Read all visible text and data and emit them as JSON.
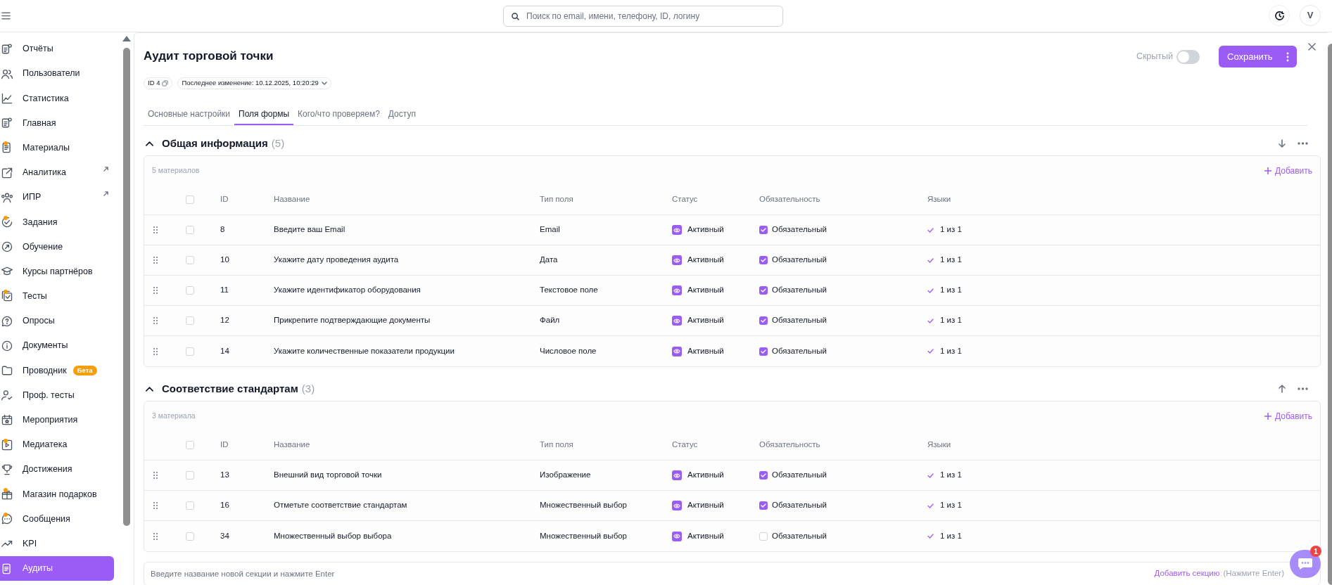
{
  "search": {
    "placeholder": "Поиск по email, имени, телефону, ID, логину"
  },
  "user": {
    "avatar": "V"
  },
  "sidebar": {
    "items": [
      {
        "label": "Отчёты",
        "notify": false,
        "external": false,
        "selected": false
      },
      {
        "label": "Пользователи",
        "notify": false,
        "external": false,
        "selected": false
      },
      {
        "label": "Статистика",
        "notify": false,
        "external": false,
        "selected": false
      },
      {
        "label": "Главная",
        "notify": false,
        "external": false,
        "selected": false
      },
      {
        "label": "Материалы",
        "notify": true,
        "external": false,
        "selected": false
      },
      {
        "label": "Аналитика",
        "notify": false,
        "external": true,
        "selected": false
      },
      {
        "label": "ИПР",
        "notify": false,
        "external": true,
        "selected": false
      },
      {
        "label": "Задания",
        "notify": true,
        "external": false,
        "selected": false
      },
      {
        "label": "Обучение",
        "notify": false,
        "external": false,
        "selected": false
      },
      {
        "label": "Курсы партнёров",
        "notify": false,
        "external": false,
        "selected": false
      },
      {
        "label": "Тесты",
        "notify": true,
        "external": false,
        "selected": false
      },
      {
        "label": "Опросы",
        "notify": false,
        "external": false,
        "selected": false
      },
      {
        "label": "Документы",
        "notify": false,
        "external": false,
        "selected": false
      },
      {
        "label": "Проводник",
        "notify": false,
        "external": false,
        "selected": false,
        "badge": "Бета"
      },
      {
        "label": "Проф. тесты",
        "notify": false,
        "external": false,
        "selected": false
      },
      {
        "label": "Мероприятия",
        "notify": false,
        "external": false,
        "selected": false
      },
      {
        "label": "Медиатека",
        "notify": true,
        "external": false,
        "selected": false
      },
      {
        "label": "Достижения",
        "notify": false,
        "external": false,
        "selected": false
      },
      {
        "label": "Магазин подарков",
        "notify": true,
        "external": false,
        "selected": false
      },
      {
        "label": "Сообщения",
        "notify": true,
        "external": false,
        "selected": false
      },
      {
        "label": "KPI",
        "notify": false,
        "external": false,
        "selected": false
      },
      {
        "label": "Аудиты",
        "notify": false,
        "external": false,
        "selected": true
      }
    ]
  },
  "page": {
    "title": "Аудит торговой точки",
    "id_chip": "ID 4",
    "last_change": "Последнее изменение: 10.12.2025, 10:20:29",
    "hidden_toggle": {
      "label": "Скрытый",
      "on": false
    },
    "save_button": "Сохранить"
  },
  "tabs": [
    {
      "label": "Основные настройки",
      "selected": false
    },
    {
      "label": "Поля формы",
      "selected": true
    },
    {
      "label": "Кого/что проверяем?",
      "selected": false
    },
    {
      "label": "Доступ",
      "selected": false
    }
  ],
  "sections": [
    {
      "title": "Общая информация",
      "count": "(5)",
      "expanded": true,
      "can_move_down": true,
      "can_move_up": false,
      "materials": "5 материалов",
      "add": "Добавить",
      "all_checked": false,
      "columns": [
        "ID",
        "Название",
        "Тип поля",
        "Статус",
        "Обязательность",
        "Языки"
      ],
      "rows": [
        {
          "checked": false,
          "id": "8",
          "name": "Введите ваш Email",
          "type": "Email",
          "status": "Активный",
          "required": true,
          "required_label": "Обязательный",
          "languages": "1 из 1"
        },
        {
          "checked": false,
          "id": "10",
          "name": "Укажите дату проведения аудита",
          "type": "Дата",
          "status": "Активный",
          "required": true,
          "required_label": "Обязательный",
          "languages": "1 из 1"
        },
        {
          "checked": false,
          "id": "11",
          "name": "Укажите идентификатор оборудования",
          "type": "Текстовое поле",
          "status": "Активный",
          "required": true,
          "required_label": "Обязательный",
          "languages": "1 из 1"
        },
        {
          "checked": false,
          "id": "12",
          "name": "Прикрепите подтверждающие документы",
          "type": "Файл",
          "status": "Активный",
          "required": true,
          "required_label": "Обязательный",
          "languages": "1 из 1"
        },
        {
          "checked": false,
          "id": "14",
          "name": "Укажите количественные показатели продукции",
          "type": "Числовое поле",
          "status": "Активный",
          "required": true,
          "required_label": "Обязательный",
          "languages": "1 из 1"
        }
      ]
    },
    {
      "title": "Соответствие стандартам",
      "count": "(3)",
      "expanded": true,
      "can_move_down": false,
      "can_move_up": true,
      "materials": "3 материала",
      "add": "Добавить",
      "all_checked": false,
      "columns": [
        "ID",
        "Название",
        "Тип поля",
        "Статус",
        "Обязательность",
        "Языки"
      ],
      "rows": [
        {
          "checked": false,
          "id": "13",
          "name": "Внешний вид торговой точки",
          "type": "Изображение",
          "status": "Активный",
          "required": true,
          "required_label": "Обязательный",
          "languages": "1 из 1"
        },
        {
          "checked": false,
          "id": "16",
          "name": "Отметьте соответствие стандартам",
          "type": "Множественный выбор",
          "status": "Активный",
          "required": true,
          "required_label": "Обязательный",
          "languages": "1 из 1"
        },
        {
          "checked": false,
          "id": "34",
          "name": "Множественный выбор выбора",
          "type": "Множественный выбор",
          "status": "Активный",
          "required": false,
          "required_label": "Обязательный",
          "languages": "1 из 1"
        }
      ]
    }
  ],
  "new_section": {
    "placeholder": "Введите название новой секции и нажмите Enter",
    "add_link": "Добавить секцию",
    "hint": "(Нажмите Enter)"
  },
  "chat": {
    "unread": "1"
  }
}
